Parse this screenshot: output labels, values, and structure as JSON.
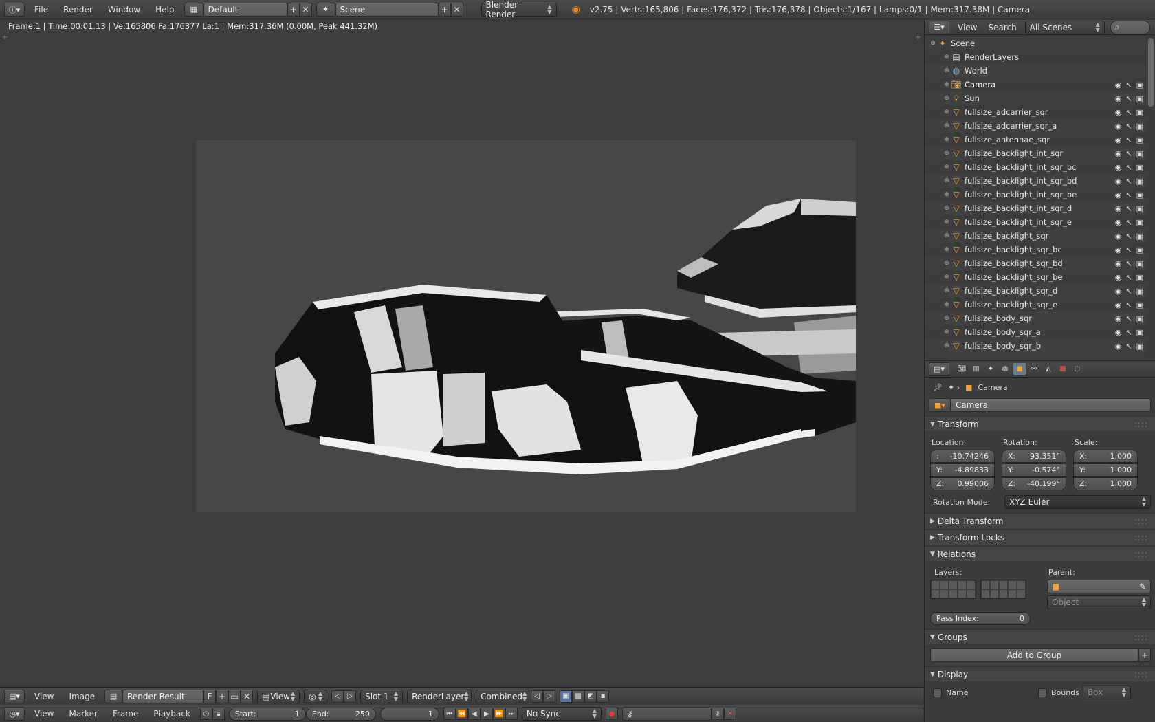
{
  "topbar": {
    "menus": [
      "File",
      "Render",
      "Window",
      "Help"
    ],
    "layout_name": "Default",
    "scene_name": "Scene",
    "engine": "Blender Render",
    "stats": "v2.75 | Verts:165,806 | Faces:176,372 | Tris:176,378 | Objects:1/167 | Lamps:0/1 | Mem:317.38M | Camera"
  },
  "viewport": {
    "frame_info": "Frame:1 | Time:00:01.13 | Ve:165806 Fa:176377 La:1 | Mem:317.36M (0.00M, Peak 441.32M)"
  },
  "image_editor_footer": {
    "view": "View",
    "image": "Image",
    "image_name": "Render Result",
    "fake_user": "F",
    "view_menu": "View",
    "slot": "Slot 1",
    "render_layer": "RenderLayer",
    "pass": "Combined"
  },
  "timeline": {
    "view": "View",
    "marker": "Marker",
    "frame": "Frame",
    "playback": "Playback",
    "start_label": "Start:",
    "start_value": "1",
    "end_label": "End:",
    "end_value": "250",
    "current_frame": "1",
    "sync": "No Sync"
  },
  "outliner": {
    "view": "View",
    "search": "Search",
    "display_mode": "All Scenes",
    "rows": [
      {
        "name": "Scene",
        "icon": "scene-icon",
        "indent": 0,
        "restrict": false
      },
      {
        "name": "RenderLayers",
        "icon": "renderlayers-icon",
        "indent": 1,
        "restrict": false
      },
      {
        "name": "World",
        "icon": "world-icon",
        "indent": 1,
        "restrict": false
      },
      {
        "name": "Camera",
        "icon": "camera-icon",
        "indent": 1,
        "restrict": true,
        "selected": true
      },
      {
        "name": "Sun",
        "icon": "lamp-icon",
        "indent": 1,
        "restrict": true
      },
      {
        "name": "fullsize_adcarrier_sqr",
        "icon": "mesh-icon",
        "indent": 1,
        "restrict": true
      },
      {
        "name": "fullsize_adcarrier_sqr_a",
        "icon": "mesh-icon",
        "indent": 1,
        "restrict": true
      },
      {
        "name": "fullsize_antennae_sqr",
        "icon": "mesh-icon",
        "indent": 1,
        "restrict": true
      },
      {
        "name": "fullsize_backlight_int_sqr",
        "icon": "mesh-icon",
        "indent": 1,
        "restrict": true
      },
      {
        "name": "fullsize_backlight_int_sqr_bc",
        "icon": "mesh-icon",
        "indent": 1,
        "restrict": true
      },
      {
        "name": "fullsize_backlight_int_sqr_bd",
        "icon": "mesh-icon",
        "indent": 1,
        "restrict": true
      },
      {
        "name": "fullsize_backlight_int_sqr_be",
        "icon": "mesh-icon",
        "indent": 1,
        "restrict": true
      },
      {
        "name": "fullsize_backlight_int_sqr_d",
        "icon": "mesh-icon",
        "indent": 1,
        "restrict": true
      },
      {
        "name": "fullsize_backlight_int_sqr_e",
        "icon": "mesh-icon",
        "indent": 1,
        "restrict": true
      },
      {
        "name": "fullsize_backlight_sqr",
        "icon": "mesh-icon",
        "indent": 1,
        "restrict": true
      },
      {
        "name": "fullsize_backlight_sqr_bc",
        "icon": "mesh-icon",
        "indent": 1,
        "restrict": true
      },
      {
        "name": "fullsize_backlight_sqr_bd",
        "icon": "mesh-icon",
        "indent": 1,
        "restrict": true
      },
      {
        "name": "fullsize_backlight_sqr_be",
        "icon": "mesh-icon",
        "indent": 1,
        "restrict": true
      },
      {
        "name": "fullsize_backlight_sqr_d",
        "icon": "mesh-icon",
        "indent": 1,
        "restrict": true
      },
      {
        "name": "fullsize_backlight_sqr_e",
        "icon": "mesh-icon",
        "indent": 1,
        "restrict": true
      },
      {
        "name": "fullsize_body_sqr",
        "icon": "mesh-icon",
        "indent": 1,
        "restrict": true
      },
      {
        "name": "fullsize_body_sqr_a",
        "icon": "mesh-icon",
        "indent": 1,
        "restrict": true
      },
      {
        "name": "fullsize_body_sqr_b",
        "icon": "mesh-icon",
        "indent": 1,
        "restrict": true
      }
    ]
  },
  "properties": {
    "context_object": "Camera",
    "object_name": "Camera",
    "transform": {
      "title": "Transform",
      "location_label": "Location:",
      "rotation_label": "Rotation:",
      "scale_label": "Scale:",
      "location": [
        {
          "axis": ":",
          "value": "-10.74246"
        },
        {
          "axis": "Y:",
          "value": "-4.89833"
        },
        {
          "axis": "Z:",
          "value": "0.99006"
        }
      ],
      "rotation": [
        {
          "axis": "X:",
          "value": "93.351°"
        },
        {
          "axis": "Y:",
          "value": "-0.574°"
        },
        {
          "axis": "Z:",
          "value": "-40.199°"
        }
      ],
      "scale": [
        {
          "axis": "X:",
          "value": "1.000"
        },
        {
          "axis": "Y:",
          "value": "1.000"
        },
        {
          "axis": "Z:",
          "value": "1.000"
        }
      ],
      "rotation_mode_label": "Rotation Mode:",
      "rotation_mode": "XYZ Euler"
    },
    "delta_transform": "Delta Transform",
    "transform_locks": "Transform Locks",
    "relations": {
      "title": "Relations",
      "layers_label": "Layers:",
      "parent_label": "Parent:",
      "parent_type": "Object",
      "pass_index_label": "Pass Index:",
      "pass_index": "0"
    },
    "groups": {
      "title": "Groups",
      "add_to_group": "Add to Group"
    },
    "display": {
      "title": "Display",
      "name_label": "Name",
      "bounds_label": "Bounds",
      "bounds_type": "Box"
    }
  }
}
